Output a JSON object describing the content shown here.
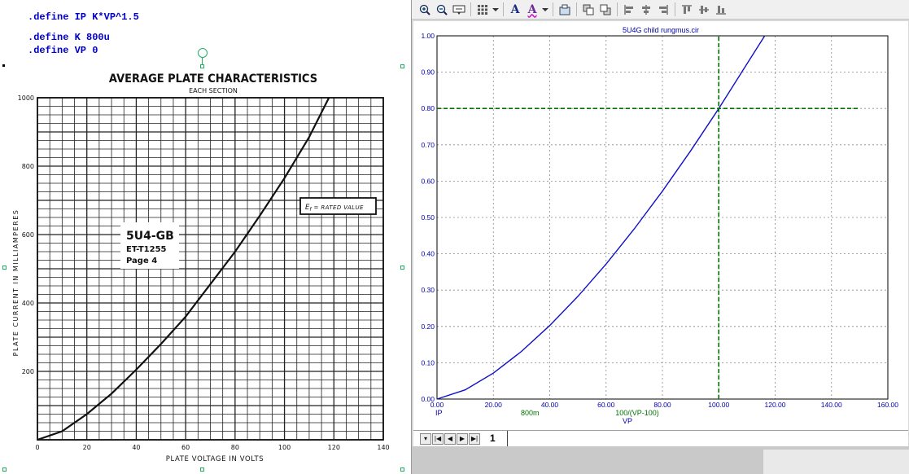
{
  "schematic": {
    "defines": [
      ".define IP K*VP^1.5",
      ".define K 800u",
      ".define VP 0"
    ]
  },
  "datasheet": {
    "title": "AVERAGE PLATE CHARACTERISTICS",
    "subtitle": "EACH SECTION",
    "ylabel": "PLATE CURRENT IN MILLIAMPERES",
    "xlabel": "PLATE VOLTAGE IN VOLTS",
    "tube_name": "5U4-GB",
    "part_number": "ET-T1255",
    "page": "Page 4",
    "ef_symbol": "E",
    "ef_sub": "f",
    "ef_value": "= RATED VALUE",
    "x_ticks": [
      "0",
      "20",
      "40",
      "60",
      "80",
      "100",
      "120",
      "140"
    ],
    "y_ticks": [
      "200",
      "400",
      "600",
      "800",
      "1000"
    ]
  },
  "toolbar": {
    "icons": [
      "zoom-in-icon",
      "zoom-out-icon",
      "zoom-fit-icon",
      "grid-icon",
      "dropdown-icon",
      "font-icon",
      "text-style-icon",
      "dropdown-icon",
      "copy-graph-icon",
      "bring-front-icon",
      "send-back-icon",
      "align-left-icon",
      "align-center-icon",
      "align-right-icon",
      "align-top-icon",
      "align-middle-icon",
      "align-bottom-icon"
    ],
    "font_letter": "A",
    "style_letter": "A"
  },
  "plot": {
    "title": "5U4G child rungmus.cir",
    "x_axis_label": "VP",
    "legend_ip": "IP",
    "legend_800m": "800m",
    "legend_expr": "100/(VP-100)"
  },
  "tabs": {
    "active": "1"
  },
  "colors": {
    "curve": "#1010c8",
    "cursor": "#007000",
    "axis_text": "#0000aa",
    "grid": "#888888"
  },
  "chart_data": [
    {
      "type": "line",
      "title": "AVERAGE PLATE CHARACTERISTICS",
      "subtitle": "EACH SECTION",
      "xlabel": "PLATE VOLTAGE IN VOLTS",
      "ylabel": "PLATE CURRENT IN MILLIAMPERES",
      "xlim": [
        0,
        140
      ],
      "ylim": [
        0,
        1000
      ],
      "grid": true,
      "series": [
        {
          "x": [
            0,
            10,
            20,
            30,
            40,
            50,
            60,
            70,
            80,
            90,
            100,
            110,
            118
          ],
          "values": [
            0,
            25,
            75,
            135,
            205,
            280,
            360,
            455,
            550,
            655,
            765,
            885,
            1000
          ]
        }
      ]
    },
    {
      "type": "line",
      "title": "5U4G child rungmus.cir",
      "xlabel": "VP",
      "xlim": [
        0,
        160
      ],
      "ylim": [
        0,
        1
      ],
      "grid": true,
      "series": [
        {
          "name": "IP",
          "x": [
            0,
            10,
            20,
            30,
            40,
            50,
            60,
            70,
            80,
            90,
            100,
            110,
            116.3
          ],
          "values": [
            0,
            0.0253,
            0.0716,
            0.1315,
            0.2024,
            0.2828,
            0.3718,
            0.4685,
            0.5724,
            0.6831,
            0.8,
            0.9229,
            1.0
          ]
        },
        {
          "name": "800m",
          "x": [
            0,
            150
          ],
          "values": [
            0.8,
            0.8
          ]
        },
        {
          "name": "100/(VP-100)",
          "x": [
            100,
            100
          ],
          "values": [
            0,
            1
          ]
        }
      ]
    }
  ]
}
